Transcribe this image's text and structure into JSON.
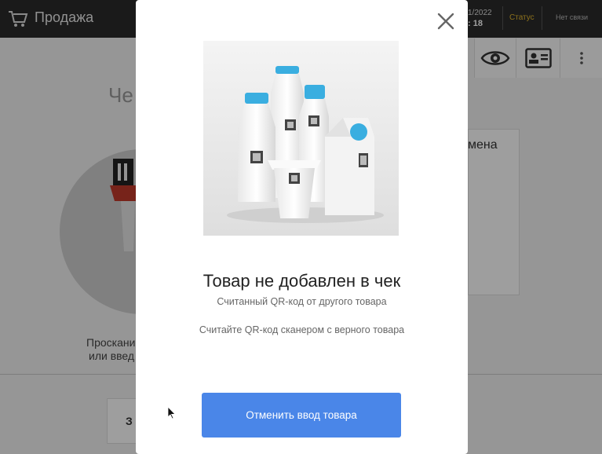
{
  "app": {
    "title": "Продажа",
    "date": "1/2022",
    "time": ": 18",
    "status": "Статус",
    "network": "Нет связи",
    "check_heading": "Че",
    "scan_line1": "Проскани",
    "scan_line2": "или введ",
    "right_card_label": "мена",
    "bottom_button_label": "З",
    "icons": {
      "cart": "cart-icon",
      "eye": "eye-icon",
      "id_card": "id-card-icon",
      "more": "more-vertical-icon"
    },
    "colors": {
      "topbar": "#2b2b2b",
      "status": "#e2b62e"
    }
  },
  "modal": {
    "title": "Товар не добавлен в чек",
    "subtitle": "Считанный QR-код от другого товара",
    "hint": "Считайте QR-код сканером с верного товара",
    "cancel_button": "Отменить ввод товара",
    "close_icon": "close-icon",
    "image": "dairy-products-with-qr-codes",
    "colors": {
      "button": "#4a86e8",
      "cap": "#3aaee0"
    }
  }
}
